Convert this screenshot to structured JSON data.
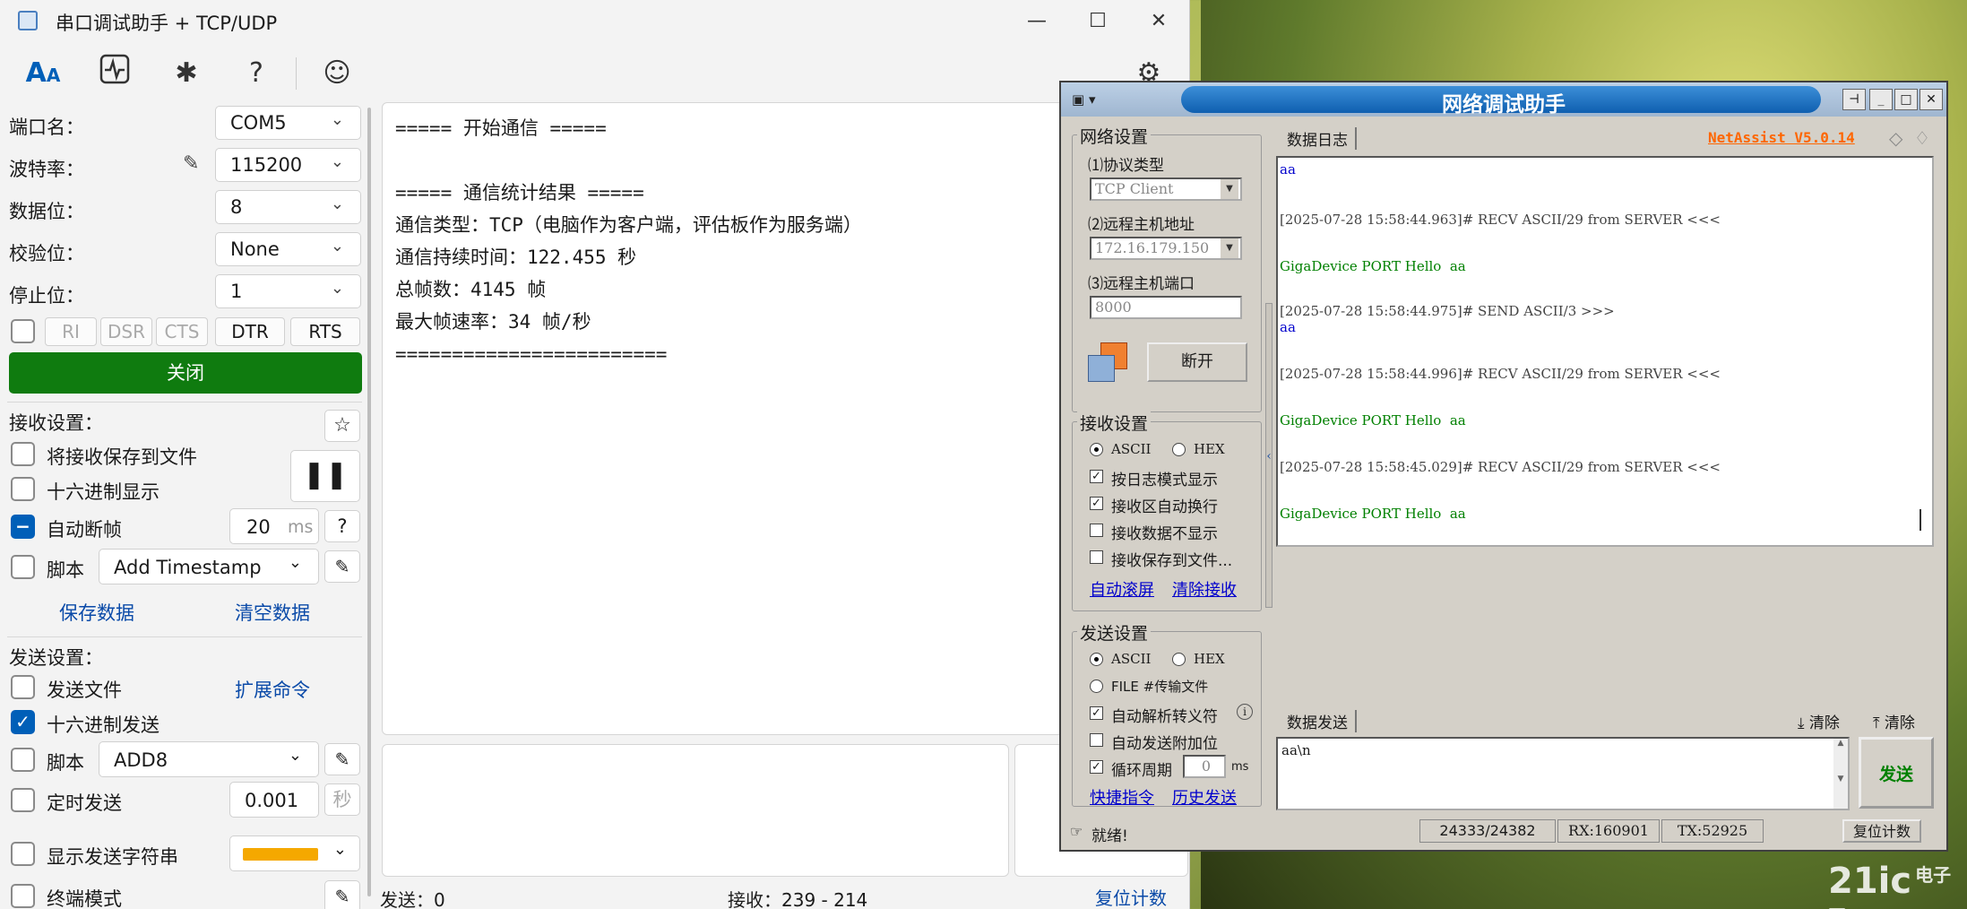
{
  "serial": {
    "title": "串口调试助手 + TCP/UDP",
    "toolbar_icons": [
      "text-format-icon",
      "waveform-icon",
      "plugin-icon",
      "help-icon",
      "smiley-icon",
      "settings-icon"
    ],
    "port_label": "端口名：",
    "port_value": "COM5",
    "baud_label": "波特率：",
    "baud_value": "115200",
    "data_label": "数据位：",
    "data_value": "8",
    "parity_label": "校验位：",
    "parity_value": "None",
    "stop_label": "停止位：",
    "stop_value": "1",
    "signals": [
      "RI",
      "DSR",
      "CTS",
      "DTR",
      "RTS"
    ],
    "close_button": "关闭",
    "recv_settings_label": "接收设置：",
    "save_to_file": "将接收保存到文件",
    "hex_display": "十六进制显示",
    "auto_frame": "自动断帧",
    "auto_frame_value": "20",
    "auto_frame_unit": "ms",
    "help": "?",
    "script_label": "脚本",
    "script_value": "Add Timestamp",
    "save_data": "保存数据",
    "clear_data": "清空数据",
    "send_settings_label": "发送设置：",
    "send_file": "发送文件",
    "ext_cmd": "扩展命令",
    "hex_send": "十六进制发送",
    "send_script_label": "脚本",
    "send_script_value": "ADD8",
    "timed_send": "定时发送",
    "timed_value": "0.001",
    "timed_unit": "秒",
    "show_send_str": "显示发送字符串",
    "terminal_mode": "终端模式",
    "status_send": "发送：0",
    "status_recv": "接收：239  -  214",
    "reset_count": "复位计数",
    "recv_text": "===== 开始通信 =====\n\n===== 通信统计结果 =====\n通信类型：TCP（电脑作为客户端，评估板作为服务端）\n通信持续时间：122.455 秒\n总帧数：4145 帧\n最大帧速率：34 帧/秒\n========================"
  },
  "net": {
    "title": "网络调试助手",
    "net_settings": "网络设置",
    "protocol_label": "⑴协议类型",
    "protocol_value": "TCP Client",
    "host_label": "⑵远程主机地址",
    "host_value": "172.16.179.150",
    "port_label": "⑶远程主机端口",
    "port_value": "8000",
    "disconnect": "断开",
    "recv_settings": "接收设置",
    "ascii": "ASCII",
    "hex": "HEX",
    "log_mode": "按日志模式显示",
    "auto_wrap": "接收区自动换行",
    "no_display": "接收数据不显示",
    "save_file": "接收保存到文件...",
    "auto_scroll": "自动滚屏",
    "clear_recv": "清除接收",
    "send_settings": "发送设置",
    "file_mode": "FILE #传输文件",
    "escape": "自动解析转义符",
    "append_bit": "自动发送附加位",
    "cycle": "循环周期",
    "cycle_value": "0",
    "cycle_unit": "ms",
    "shortcut": "快捷指令",
    "history": "历史发送",
    "log_tab": "数据日志",
    "version": "NetAssist V5.0.14",
    "log_lines": [
      {
        "text": "aa",
        "color": "#0000cc"
      },
      {
        "text": "[2025-07-28 15:58:44.963]# RECV ASCII/29 from SERVER <<<",
        "color": "#444444"
      },
      {
        "text": "GigaDevice PORT Hello  aa",
        "color": "#008000"
      },
      {
        "text": "[2025-07-28 15:58:44.975]# SEND ASCII/3 >>>",
        "color": "#444444"
      },
      {
        "text": "aa",
        "color": "#0000cc"
      },
      {
        "text": "[2025-07-28 15:58:44.996]# RECV ASCII/29 from SERVER <<<",
        "color": "#444444"
      },
      {
        "text": "GigaDevice PORT Hello  aa",
        "color": "#008000"
      },
      {
        "text": "[2025-07-28 15:58:45.029]# RECV ASCII/29 from SERVER <<<",
        "color": "#444444"
      },
      {
        "text": "GigaDevice PORT Hello  aa",
        "color": "#008000"
      }
    ],
    "send_tab": "数据发送",
    "clear1": "清除",
    "clear2": "清除",
    "send_text": "aa\\n",
    "send_button": "发送",
    "status_ready": "就绪!",
    "count": "24333/24382",
    "rx": "RX:160901",
    "tx": "TX:52925",
    "reset": "复位计数"
  },
  "watermark": "21ic",
  "watermark_sub": "电子网"
}
